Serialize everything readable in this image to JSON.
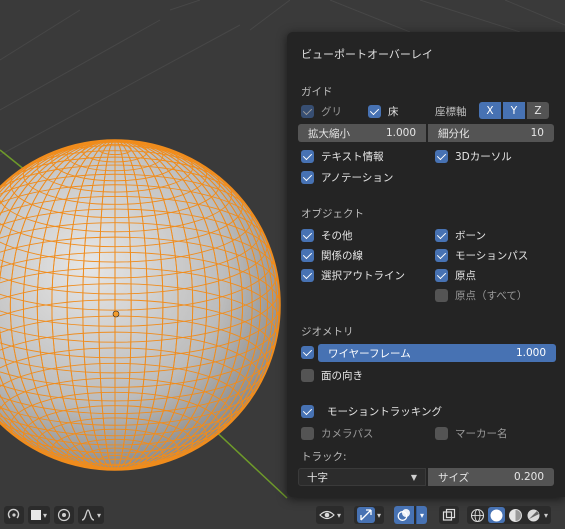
{
  "panel": {
    "title": "ビューポートオーバーレイ",
    "guides": {
      "heading": "ガイド",
      "grid_label": "グリ",
      "floor_label": "床",
      "axes_label": "座標軸",
      "axes": [
        "X",
        "Y",
        "Z"
      ],
      "scale_label": "拡大縮小",
      "scale_value": "1.000",
      "subdiv_label": "細分化",
      "subdiv_value": "10",
      "text_info": "テキスト情報",
      "cursor3d": "3Dカーソル",
      "annotations": "アノテーション"
    },
    "objects": {
      "heading": "オブジェクト",
      "extras": "その他",
      "bones": "ボーン",
      "relations": "関係の線",
      "motion_paths": "モーションパス",
      "outline": "選択アウトライン",
      "origins": "原点",
      "origins_all": "原点（すべて）"
    },
    "geometry": {
      "heading": "ジオメトリ",
      "wireframe": "ワイヤーフレーム",
      "wireframe_value": "1.000",
      "wireframe_fraction": 1.0,
      "face_orientation": "面の向き"
    },
    "tracking": {
      "motion_tracking": "モーショントラッキング",
      "camera_path": "カメラパス",
      "marker_names": "マーカー名",
      "tracks_label": "トラック:",
      "track_type": "十字",
      "size_label": "サイズ",
      "size_value": "0.200"
    }
  },
  "colors": {
    "accent": "#4772b3",
    "panel_bg": "#242424",
    "wire": "#f08c1c",
    "grid_axis": "#6e9a2a"
  },
  "icons": [
    "help-icon",
    "square-icon",
    "proportional-edit-icon",
    "falloff-icon",
    "eye-icon",
    "gizmo-icon",
    "overlay-icon",
    "xray-icon",
    "wireframe-shading-icon",
    "solid-shading-icon",
    "material-shading-icon",
    "rendered-shading-icon"
  ]
}
